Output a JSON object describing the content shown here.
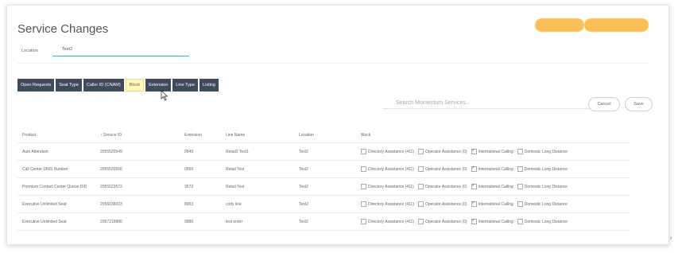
{
  "page": {
    "title": "Service Changes",
    "location_label": "Location",
    "location_value": "Test2"
  },
  "tabs": [
    {
      "label": "Open Requests",
      "active": false
    },
    {
      "label": "Seat Type",
      "active": false
    },
    {
      "label": "Caller ID (CNAM)",
      "active": false
    },
    {
      "label": "Block",
      "active": true
    },
    {
      "label": "Extension",
      "active": false
    },
    {
      "label": "Line Type",
      "active": false
    },
    {
      "label": "Listing",
      "active": false
    }
  ],
  "search": {
    "placeholder": "Search Momentum Services..."
  },
  "actions": {
    "cancel_label": "Cancel",
    "save_label": "Save"
  },
  "table": {
    "columns": [
      "Product",
      "Service ID",
      "Extension",
      "Line Name",
      "Location",
      "Block"
    ],
    "sort_column": "Service ID",
    "block_options": [
      "Directory Assistance (411)",
      "Operator Assistance (0)",
      "International Calling",
      "Domestic Long Distance"
    ],
    "rows": [
      {
        "product": "Auto Attendant",
        "service_id": "2055520549",
        "extension": "0549",
        "line_name": "Retail2 Test1",
        "location": "Test2",
        "block": [
          false,
          false,
          true,
          false
        ]
      },
      {
        "product": "Call Center DNIS Number",
        "service_id": "2055520556",
        "extension": "0556",
        "line_name": "Retail Test",
        "location": "Test2",
        "block": [
          false,
          false,
          true,
          false
        ]
      },
      {
        "product": "Premium Contact Center Queue DID",
        "service_id": "2055523572",
        "extension": "3572",
        "line_name": "Retail Test",
        "location": "Test2",
        "block": [
          false,
          false,
          true,
          false
        ]
      },
      {
        "product": "Executive Unlimited Seat",
        "service_id": "2056038003",
        "extension": "8003",
        "line_name": "cody line",
        "location": "Test2",
        "block": [
          false,
          false,
          true,
          false
        ]
      },
      {
        "product": "Executive Unlimited Seat",
        "service_id": "2057219886",
        "extension": "9886",
        "line_name": "test order",
        "location": "Test2",
        "block": [
          false,
          false,
          true,
          false
        ]
      }
    ]
  },
  "colors": {
    "tab_bg": "#3d4b5c",
    "tab_active_bg": "#fff8b8",
    "accent_orange": "#fbb43a",
    "input_underline": "#5ba88c"
  }
}
